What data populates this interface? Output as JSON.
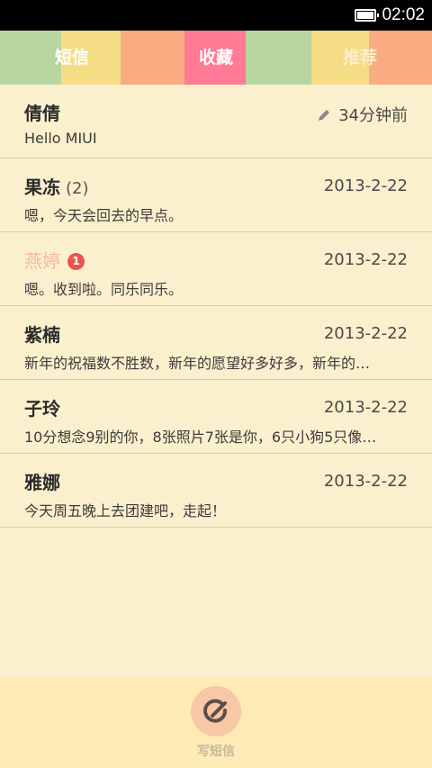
{
  "status_bar": {
    "time": "02:02",
    "battery_level": 0.9
  },
  "tabs": [
    {
      "label": "短信",
      "color": "#a8c98f"
    },
    {
      "label": "收藏",
      "color": "#f0768f"
    },
    {
      "label": "推荐",
      "color": "#f5d97e"
    }
  ],
  "colors": {
    "background": "#fbf0cd",
    "stripe_green": "#b9d59f",
    "stripe_yellow": "#f5dd86",
    "stripe_orange": "#f9ac82",
    "stripe_pink": "#ff7b95",
    "unread_name": "#f9b5a5",
    "badge": "#e8574f"
  },
  "messages": [
    {
      "name": "倩倩",
      "date": "34分钟前",
      "preview": "Hello MIUI",
      "icon": "pencil-icon"
    },
    {
      "name": "果冻",
      "count": "(2)",
      "date": "2013-2-22",
      "preview": "嗯，今天会回去的早点。"
    },
    {
      "name": "燕婷",
      "badge": "1",
      "date": "2013-2-22",
      "preview": "嗯。收到啦。同乐同乐。"
    },
    {
      "name": "紫楠",
      "date": "2013-2-22",
      "preview": "新年的祝福数不胜数，新年的愿望好多好多，新年的…"
    },
    {
      "name": "子玲",
      "date": "2013-2-22",
      "preview": "10分想念9别的你，8张照片7张是你，6只小狗5只像…"
    },
    {
      "name": "雅娜",
      "date": "2013-2-22",
      "preview": "今天周五晚上去团建吧，走起！"
    }
  ],
  "footer": {
    "compose_label": "写短信",
    "compose_icon": "compose-icon"
  }
}
